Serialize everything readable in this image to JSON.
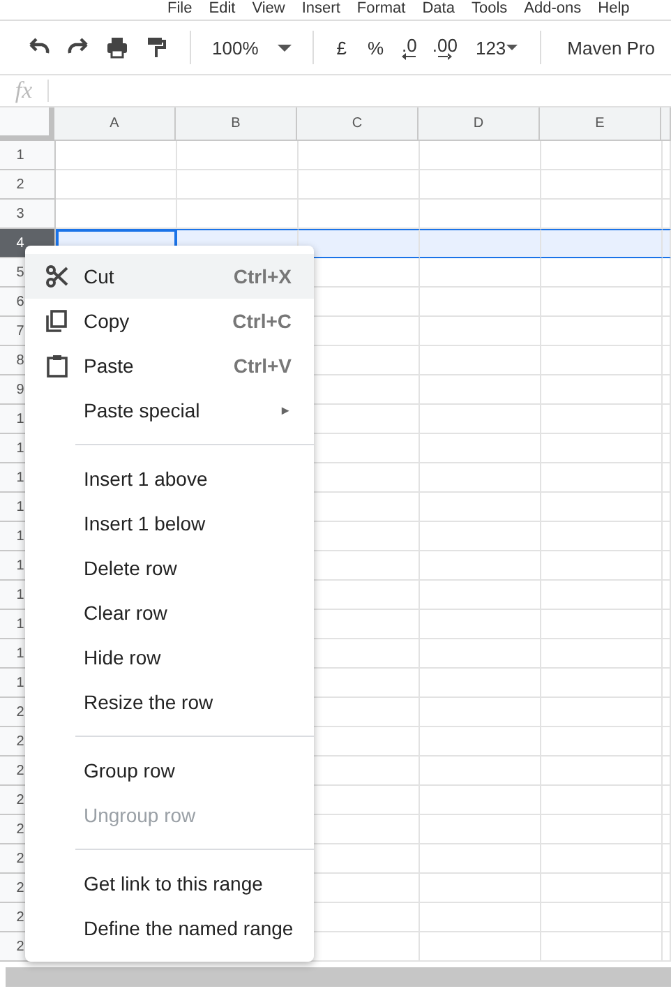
{
  "menu_bar": [
    "File",
    "Edit",
    "View",
    "Insert",
    "Format",
    "Data",
    "Tools",
    "Add-ons",
    "Help"
  ],
  "toolbar": {
    "zoom": "100%",
    "currency": "£",
    "percent": "%",
    "decrease_decimals": ".0",
    "increase_decimals": ".00",
    "number_format": "123",
    "font": "Maven Pro"
  },
  "formula_bar": {
    "label": "fx"
  },
  "columns": [
    "A",
    "B",
    "C",
    "D",
    "E"
  ],
  "rows": [
    {
      "label": "1",
      "selected": false
    },
    {
      "label": "2",
      "selected": false
    },
    {
      "label": "3",
      "selected": false
    },
    {
      "label": "4",
      "selected": true
    },
    {
      "label": "5",
      "selected": false
    },
    {
      "label": "6",
      "selected": false
    },
    {
      "label": "7",
      "selected": false
    },
    {
      "label": "8",
      "selected": false
    },
    {
      "label": "9",
      "selected": false
    },
    {
      "label": "1",
      "selected": false
    },
    {
      "label": "1",
      "selected": false
    },
    {
      "label": "1",
      "selected": false
    },
    {
      "label": "1",
      "selected": false
    },
    {
      "label": "1",
      "selected": false
    },
    {
      "label": "1",
      "selected": false
    },
    {
      "label": "1",
      "selected": false
    },
    {
      "label": "1",
      "selected": false
    },
    {
      "label": "1",
      "selected": false
    },
    {
      "label": "1",
      "selected": false
    },
    {
      "label": "2",
      "selected": false
    },
    {
      "label": "2",
      "selected": false
    },
    {
      "label": "2",
      "selected": false
    },
    {
      "label": "2",
      "selected": false
    },
    {
      "label": "2",
      "selected": false
    },
    {
      "label": "2",
      "selected": false
    },
    {
      "label": "2",
      "selected": false
    },
    {
      "label": "2",
      "selected": false
    },
    {
      "label": "2",
      "selected": false
    }
  ],
  "context_menu": [
    {
      "kind": "item",
      "label": "Cut",
      "shortcut": "Ctrl+X",
      "highlighted": true,
      "disabled": false
    },
    {
      "kind": "item",
      "label": "Copy",
      "shortcut": "Ctrl+C",
      "highlighted": false,
      "disabled": false
    },
    {
      "kind": "item",
      "label": "Paste",
      "shortcut": "Ctrl+V",
      "highlighted": false,
      "disabled": false
    },
    {
      "kind": "submenu",
      "label": "Paste special",
      "arrow": "►",
      "highlighted": false,
      "disabled": false
    },
    {
      "kind": "separator"
    },
    {
      "kind": "item",
      "label": "Insert 1 above",
      "highlighted": false,
      "disabled": false
    },
    {
      "kind": "item",
      "label": "Insert 1 below",
      "highlighted": false,
      "disabled": false
    },
    {
      "kind": "item",
      "label": "Delete row",
      "highlighted": false,
      "disabled": false
    },
    {
      "kind": "item",
      "label": "Clear row",
      "highlighted": false,
      "disabled": false
    },
    {
      "kind": "item",
      "label": "Hide row",
      "highlighted": false,
      "disabled": false
    },
    {
      "kind": "item",
      "label": "Resize the row",
      "highlighted": false,
      "disabled": false
    },
    {
      "kind": "separator"
    },
    {
      "kind": "item",
      "label": "Group row",
      "highlighted": false,
      "disabled": false
    },
    {
      "kind": "item",
      "label": "Ungroup row",
      "highlighted": false,
      "disabled": true
    },
    {
      "kind": "separator"
    },
    {
      "kind": "item",
      "label": "Get link to this range",
      "highlighted": false,
      "disabled": false
    },
    {
      "kind": "item",
      "label": "Define the named range",
      "highlighted": false,
      "disabled": false
    }
  ]
}
